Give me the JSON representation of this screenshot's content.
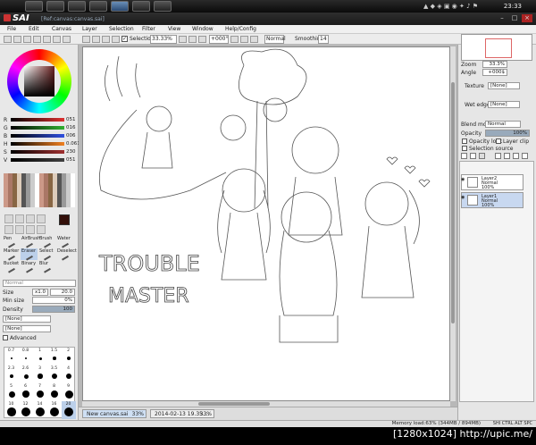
{
  "taskbar": {
    "clock": "23:33"
  },
  "window": {
    "app_name": "SAI",
    "file": "[Ref:canvas:canvas.sai]"
  },
  "menu": [
    "File",
    "Edit",
    "Canvas",
    "Layer",
    "Selection",
    "Filter",
    "View",
    "Window",
    "Help/Config"
  ],
  "toolbar": {
    "selection_label": "Selection",
    "zoom": "33.33%",
    "angle": "+000°",
    "blend": "Normal",
    "smoothing_label": "Smoothing",
    "smoothing": "14"
  },
  "color": {
    "sliders": [
      {
        "label": "R",
        "value": "051",
        "color": "#e03030"
      },
      {
        "label": "G",
        "value": "016",
        "color": "#30b030"
      },
      {
        "label": "B",
        "value": "006",
        "color": "#3050e0"
      },
      {
        "label": "H",
        "value": "0.061",
        "color": "#f08020"
      },
      {
        "label": "S",
        "value": "230",
        "color": "#a03030"
      },
      {
        "label": "V",
        "value": "051",
        "color": "#404040"
      }
    ]
  },
  "tools": [
    "Pen",
    "AirBrush",
    "Brush",
    "Water",
    "Marker",
    "Eraser",
    "Select",
    "Deselect",
    "Bucket",
    "Binary",
    "Blur"
  ],
  "brush": {
    "mode": "Normal",
    "size_label": "Size",
    "size_mult": "x1.0",
    "size_value": "20.0",
    "min_size_label": "Min size",
    "min_size": "0%",
    "density_label": "Density",
    "density": "100",
    "texture1": "[None]",
    "texture2": "[None]",
    "advanced_label": "Advanced",
    "sizes": [
      "0.7",
      "0.8",
      "1",
      "1.5",
      "2",
      "2.3",
      "2.6",
      "3",
      "3.5",
      "4",
      "5",
      "6",
      "7",
      "8",
      "9",
      "10",
      "12",
      "14",
      "16",
      "20"
    ]
  },
  "navigator": {
    "zoom_label": "Zoom",
    "zoom": "33.3%",
    "angle_label": "Angle",
    "angle": "+000$"
  },
  "layer_props": {
    "texture_label": "Texture",
    "texture": "[None]",
    "wet_edge_label": "Wet edge",
    "wet_edge": "[None]",
    "blend_label": "Blend mode",
    "blend": "Normal",
    "opacity_label": "Opacity",
    "opacity": "100%",
    "opacity_lock": "Opacity lock",
    "layer_clip": "Layer clip",
    "selection_source": "Selection source"
  },
  "layers": [
    {
      "name": "Layer2",
      "mode": "Normal",
      "opacity": "100%",
      "selected": false
    },
    {
      "name": "Layer1",
      "mode": "Normal",
      "opacity": "100%",
      "selected": true
    }
  ],
  "canvas_tabs": [
    {
      "name": "New canvas.sai",
      "zoom": "33%",
      "active": true
    },
    {
      "name": "2014-02-13 19.35....",
      "zoom": "33%",
      "active": false
    }
  ],
  "canvas": {
    "text1": "TROUBLE",
    "text2": "MASTER"
  },
  "status": {
    "memory": "Memory load:63% (344MB / 894MB)",
    "keys": "SHI CTRL ALT SPC"
  },
  "watermark": "[1280x1024]",
  "watermark_site": "http://upic.me/"
}
